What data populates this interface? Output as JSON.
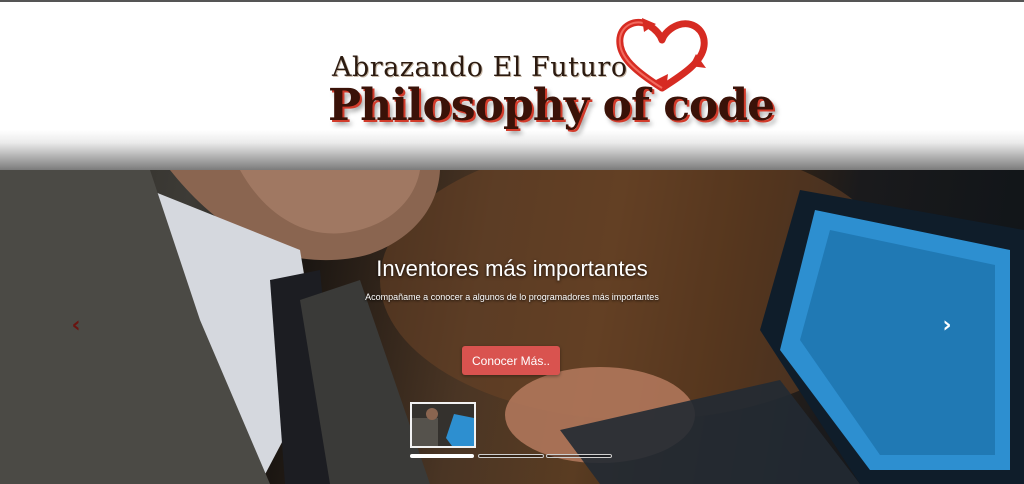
{
  "header": {
    "logo_line1": "Abrazando El Futuro",
    "logo_line2": "Philosophy of code"
  },
  "slider": {
    "title": "Inventores más importantes",
    "subtitle": "Acompañame a conocer a algunos de lo programadores más importantes",
    "button_label": "Conocer Más..",
    "prev_arrow": "‹",
    "next_arrow": "›",
    "active_slide_index": 1,
    "slide_count": 3
  },
  "colors": {
    "button": "#d9534f",
    "logo_red": "#d23b2b",
    "logo_dark": "#3a1208"
  },
  "icons": {
    "logo_emblem": "heart-arrows-icon",
    "prev": "chevron-left-icon",
    "next": "chevron-right-icon"
  }
}
